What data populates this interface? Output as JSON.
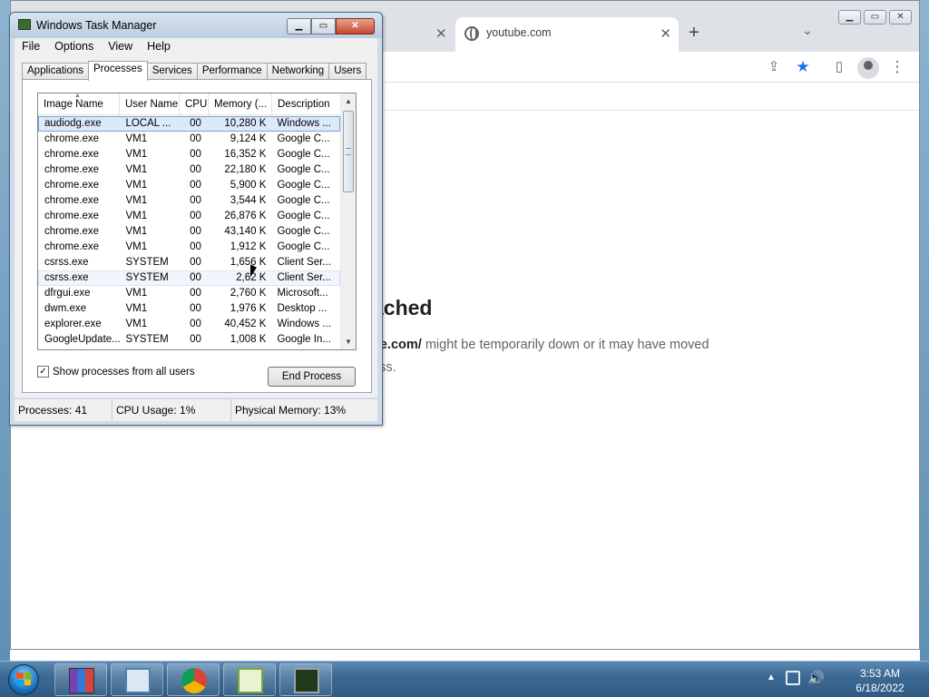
{
  "browser": {
    "tabs": [
      {
        "title": "",
        "active": false
      },
      {
        "title": "youtube.com",
        "active": true
      }
    ],
    "icons": {
      "new_tab": "+",
      "tab_search": "⌄",
      "share": "⇪",
      "star": "★",
      "side_panel": "▯",
      "menu": "⋮",
      "close_tab": "✕"
    },
    "error": {
      "heading": "ached",
      "line1_bold": "be.com/",
      "line1_rest": " might be temporarily down or it may have moved",
      "line2": "ess."
    }
  },
  "task_manager": {
    "title": "Windows Task Manager",
    "menu": [
      "File",
      "Options",
      "View",
      "Help"
    ],
    "tabs": [
      "Applications",
      "Processes",
      "Services",
      "Performance",
      "Networking",
      "Users"
    ],
    "active_tab": "Processes",
    "columns": [
      "Image Name",
      "User Name",
      "CPU",
      "Memory (...",
      "Description"
    ],
    "processes": [
      {
        "name": "audiodg.exe",
        "user": "LOCAL ...",
        "cpu": "00",
        "memory": "10,280 K",
        "description": "Windows ..."
      },
      {
        "name": "chrome.exe",
        "user": "VM1",
        "cpu": "00",
        "memory": "9,124 K",
        "description": "Google C..."
      },
      {
        "name": "chrome.exe",
        "user": "VM1",
        "cpu": "00",
        "memory": "16,352 K",
        "description": "Google C..."
      },
      {
        "name": "chrome.exe",
        "user": "VM1",
        "cpu": "00",
        "memory": "22,180 K",
        "description": "Google C..."
      },
      {
        "name": "chrome.exe",
        "user": "VM1",
        "cpu": "00",
        "memory": "5,900 K",
        "description": "Google C..."
      },
      {
        "name": "chrome.exe",
        "user": "VM1",
        "cpu": "00",
        "memory": "3,544 K",
        "description": "Google C..."
      },
      {
        "name": "chrome.exe",
        "user": "VM1",
        "cpu": "00",
        "memory": "26,876 K",
        "description": "Google C..."
      },
      {
        "name": "chrome.exe",
        "user": "VM1",
        "cpu": "00",
        "memory": "43,140 K",
        "description": "Google C..."
      },
      {
        "name": "chrome.exe",
        "user": "VM1",
        "cpu": "00",
        "memory": "1,912 K",
        "description": "Google C..."
      },
      {
        "name": "csrss.exe",
        "user": "SYSTEM",
        "cpu": "00",
        "memory": "1,656 K",
        "description": "Client Ser..."
      },
      {
        "name": "csrss.exe",
        "user": "SYSTEM",
        "cpu": "00",
        "memory": "2,62 K",
        "description": "Client Ser..."
      },
      {
        "name": "dfrgui.exe",
        "user": "VM1",
        "cpu": "00",
        "memory": "2,760 K",
        "description": "Microsoft..."
      },
      {
        "name": "dwm.exe",
        "user": "VM1",
        "cpu": "00",
        "memory": "1,976 K",
        "description": "Desktop ..."
      },
      {
        "name": "explorer.exe",
        "user": "VM1",
        "cpu": "00",
        "memory": "40,452 K",
        "description": "Windows ..."
      },
      {
        "name": "GoogleUpdate...",
        "user": "SYSTEM",
        "cpu": "00",
        "memory": "1,008 K",
        "description": "Google In..."
      }
    ],
    "selected_row": 0,
    "show_all_label": "Show processes from all users",
    "show_all_checked": true,
    "end_process_label": "End Process",
    "status": {
      "processes": "Processes: 41",
      "cpu": "CPU Usage: 1%",
      "memory": "Physical Memory: 13%"
    }
  },
  "taskbar": {
    "apps": [
      "winrar-icon",
      "control-panel-icon",
      "chrome-icon",
      "notepad-plus-icon",
      "task-manager-icon"
    ],
    "clock_time": "3:53 AM",
    "clock_date": "6/18/2022"
  }
}
